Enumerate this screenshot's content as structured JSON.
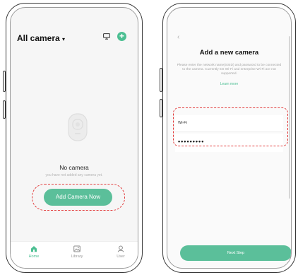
{
  "screen1": {
    "title": "All camera",
    "title_caret": "▾",
    "plus_glyph": "+",
    "empty_title": "No camera",
    "empty_subtitle": "you have not added any camera yet.",
    "add_button": "Add Camera Now",
    "tabs": [
      {
        "label": "Home",
        "icon": "home-icon",
        "active": true
      },
      {
        "label": "Library",
        "icon": "library-icon",
        "active": false
      },
      {
        "label": "User",
        "icon": "user-icon",
        "active": false
      }
    ]
  },
  "screen2": {
    "back_glyph": "‹",
    "title": "Add a new camera",
    "description": "Please enter the network name(SSID) and password to be connected to the camera. Currently 5G Wi-Fi and enterprise Wi-Fi are not supported.",
    "learn_more": "Learn more",
    "ssid_value": "Wi-Fi",
    "password_value": "•••••••••",
    "next_button": "Next Step"
  },
  "colors": {
    "accent": "#4cbf92",
    "button": "#5bbf9a",
    "highlight": "#e23b3b"
  }
}
